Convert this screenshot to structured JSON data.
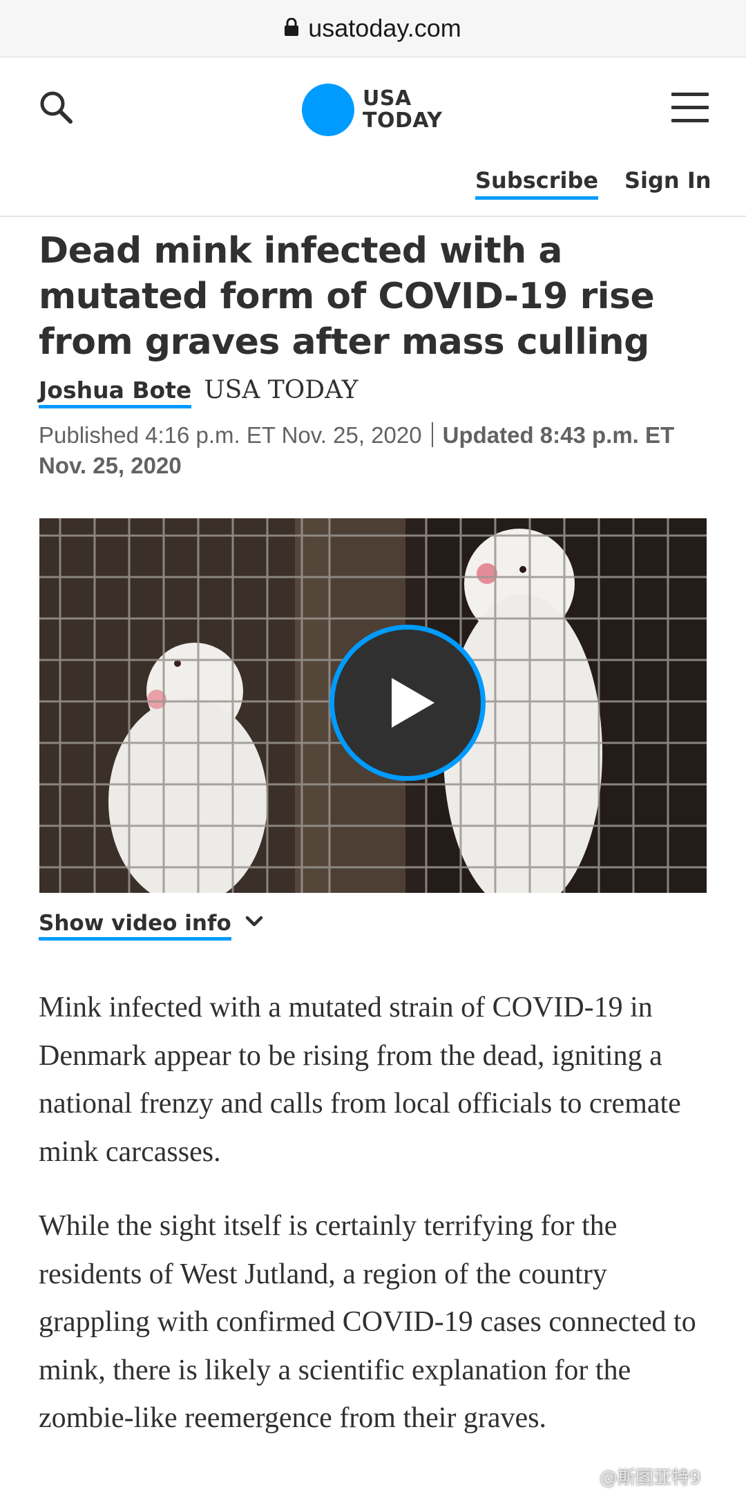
{
  "browser": {
    "url": "usatoday.com"
  },
  "header": {
    "logo_line1": "USA",
    "logo_line2": "TODAY",
    "subscribe_label": "Subscribe",
    "signin_label": "Sign In",
    "brand_color": "#009bff"
  },
  "article": {
    "headline": "Dead mink infected with a mutated form of COVID-19 rise from graves after mass culling",
    "author": "Joshua Bote",
    "source": "USA TODAY",
    "published": "Published 4:16 p.m. ET Nov. 25, 2020",
    "updated": "Updated 8:43 p.m. ET Nov. 25, 2020",
    "video_info_label": "Show video info",
    "paragraphs": [
      "Mink infected with a mutated strain of COVID-19 in Denmark appear to be rising from the dead, igniting a national frenzy and calls from local officials to cremate mink carcasses.",
      "While the sight itself is certainly terrifying for the residents of West Jutland, a region of the country grappling with confirmed COVID-19 cases connected to mink, there is likely a scientific explanation for the zombie-like reemergence from their graves."
    ]
  },
  "watermark": "@斯图亚特9"
}
